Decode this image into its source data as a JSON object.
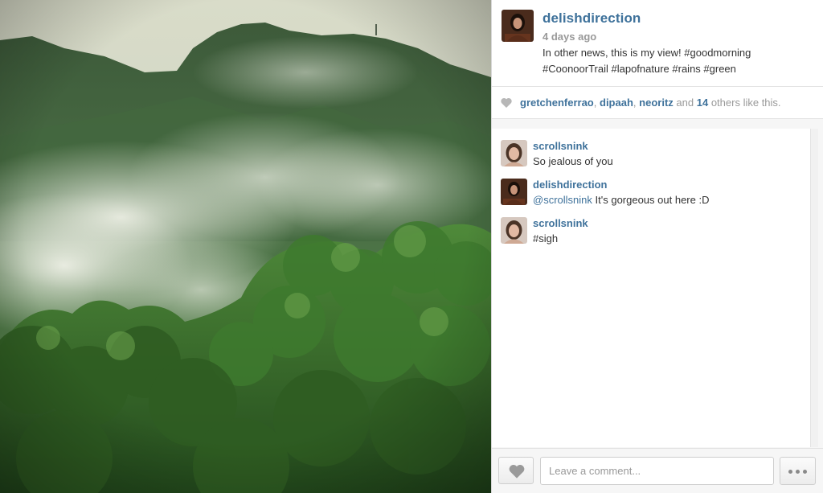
{
  "post": {
    "author": "delishdirection",
    "posted": "4 days ago",
    "caption": "In other news, this is my view! #goodmorning #CoonoorTrail #lapofnature #rains #green"
  },
  "likes": {
    "users": [
      "gretchenferrao",
      "dipaah",
      "neoritz"
    ],
    "sep_comma": ",",
    "and_text": "and",
    "others_count": "14",
    "others_text": "others like this."
  },
  "comments": [
    {
      "user": "scrollsnink",
      "mention": "",
      "text": "So jealous of you"
    },
    {
      "user": "delishdirection",
      "mention": "@scrollsnink",
      "text": "It's gorgeous out here :D"
    },
    {
      "user": "scrollsnink",
      "mention": "",
      "text": "#sigh"
    }
  ],
  "footer": {
    "comment_placeholder": "Leave a comment..."
  },
  "icons": {
    "like": "heart-icon",
    "more": "more-dots-icon"
  },
  "colors": {
    "link": "#3f729b",
    "muted": "#999999",
    "panel_bg": "#f6f6f6"
  }
}
